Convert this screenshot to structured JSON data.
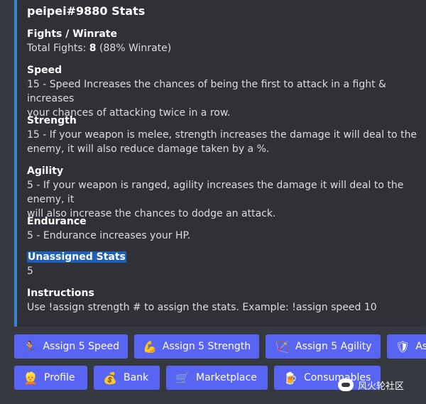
{
  "embed": {
    "title": "peipei#9880 Stats",
    "accent_color": "#3b82d6",
    "fields": [
      {
        "name": "Fights / Winrate",
        "prefix": "Total Fights: ",
        "bold": "8",
        "suffix": " (88% Winrate)"
      },
      {
        "name": "Speed",
        "line1": "15 - Speed Increases the chances of being the first to attack in a fight & increases",
        "line2": "your chances of attacking twice in a row."
      },
      {
        "name": "Strength",
        "line1": "15 - If your weapon is melee, strength increases the damage it will deal to the",
        "line2": "enemy, it will also reduce damage taken by a %."
      },
      {
        "name": "Agility",
        "line1": "5 - If your weapon is ranged, agility increases the damage it will deal to the enemy, it",
        "line2": "will also increase the chances to dodge an attack."
      },
      {
        "name": "Endurance",
        "value": "5 - Endurance increases your HP."
      },
      {
        "name": "Unassigned Stats",
        "value": "5"
      },
      {
        "name": "Instructions",
        "value": "Use !assign strength # to assign the stats. Example: !assign speed 10"
      }
    ]
  },
  "buttons_row1": [
    {
      "label": "Assign 5 Speed",
      "icon": "running-person-icon",
      "glyph": "🏃"
    },
    {
      "label": "Assign 5 Strength",
      "icon": "flexed-biceps-icon",
      "glyph": "💪"
    },
    {
      "label": "Assign 5 Agility",
      "icon": "bow-and-arrow-icon",
      "glyph": "🏹"
    },
    {
      "label": "As",
      "icon": "shield-icon",
      "glyph": "🛡"
    }
  ],
  "buttons_row2": [
    {
      "label": "Profile",
      "icon": "person-icon",
      "glyph": "👱"
    },
    {
      "label": "Bank",
      "icon": "money-bag-icon",
      "glyph": "💰"
    },
    {
      "label": "Marketplace",
      "icon": "shopping-cart-icon",
      "glyph": "🛒"
    },
    {
      "label": "Consumables",
      "icon": "beer-mug-icon",
      "glyph": "🍺"
    }
  ],
  "watermark": {
    "text": "风火轮社区"
  },
  "colors": {
    "button": "#5865f2",
    "embed_bg": "#2f3136",
    "page_bg": "#36393f",
    "highlight": "#1f5fb4"
  }
}
